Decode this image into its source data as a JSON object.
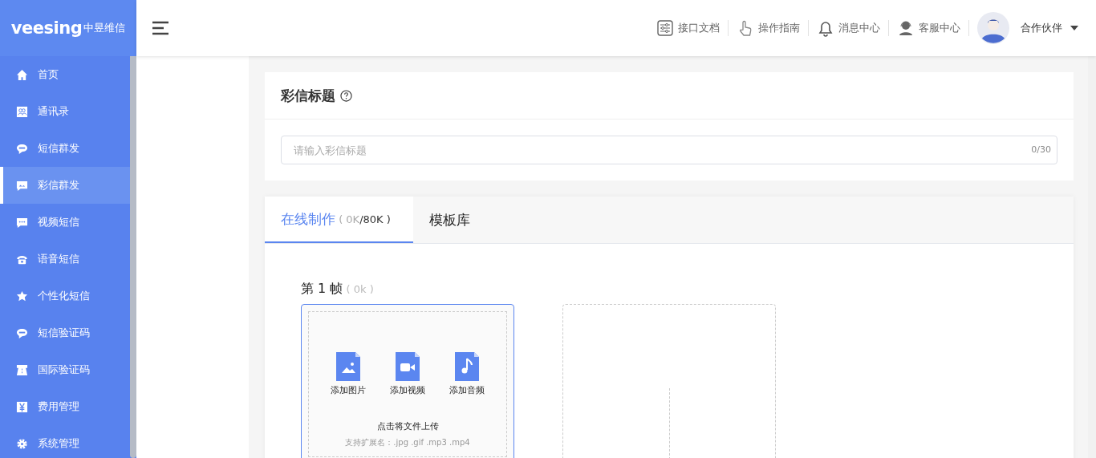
{
  "logo": {
    "text": "veesing",
    "text_cn": "中昱维信"
  },
  "sidebar": {
    "items": [
      {
        "label": "首页",
        "kind": "home",
        "selected": false
      },
      {
        "label": "通讯录",
        "kind": "contacts",
        "selected": false
      },
      {
        "label": "短信群发",
        "kind": "sms",
        "selected": false
      },
      {
        "label": "彩信群发",
        "kind": "image",
        "selected": true
      },
      {
        "label": "视频短信",
        "kind": "chat",
        "selected": false
      },
      {
        "label": "语音短信",
        "kind": "phone",
        "selected": false
      },
      {
        "label": "个性化短信",
        "kind": "star",
        "selected": false
      },
      {
        "label": "短信验证码",
        "kind": "sim",
        "selected": false
      },
      {
        "label": "国际验证码",
        "kind": "road",
        "selected": false
      },
      {
        "label": "费用管理",
        "kind": "yen",
        "selected": false
      },
      {
        "label": "系统管理",
        "kind": "gear",
        "selected": false
      }
    ]
  },
  "header": {
    "links": [
      {
        "label": "接口文档",
        "kind": "doc"
      },
      {
        "label": "操作指南",
        "kind": "hand"
      },
      {
        "label": "消息中心",
        "kind": "bell"
      },
      {
        "label": "客服中心",
        "kind": "service"
      }
    ],
    "user": "合作伙伴"
  },
  "title_section": {
    "title": "彩信标题",
    "placeholder": "请输入彩信标题",
    "counter": "0/30"
  },
  "tabs": [
    {
      "label": "在线制作",
      "size_used": "( 0K",
      "size_total": "/80K )",
      "selected": true
    },
    {
      "label": "模板库",
      "selected": false
    }
  ],
  "frame": {
    "label": "第 1 帧",
    "size": "( 0k )",
    "upload_options": [
      {
        "label": "添加图片",
        "kind": "image"
      },
      {
        "label": "添加视频",
        "kind": "video"
      },
      {
        "label": "添加音频",
        "kind": "audio"
      }
    ],
    "hint": "点击将文件上传",
    "extensions": "支持扩展名：.jpg .gif .mp3 .mp4"
  }
}
